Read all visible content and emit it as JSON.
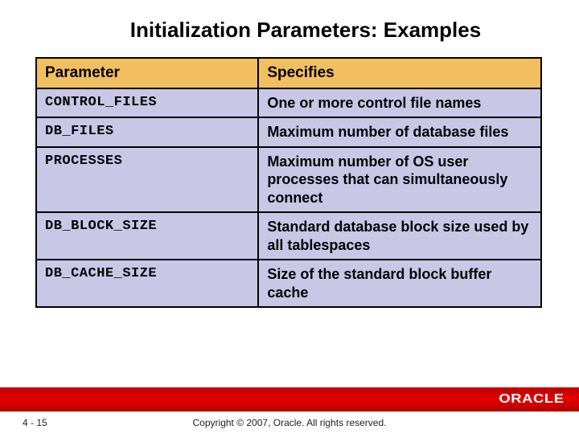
{
  "title": "Initialization Parameters: Examples",
  "table": {
    "headers": {
      "col1": "Parameter",
      "col2": "Specifies"
    },
    "rows": [
      {
        "param": "CONTROL_FILES",
        "spec": "One or more control file names"
      },
      {
        "param": "DB_FILES",
        "spec": "Maximum number of database files"
      },
      {
        "param": "PROCESSES",
        "spec": "Maximum number of OS user processes that can simultaneously connect"
      },
      {
        "param": "DB_BLOCK_SIZE",
        "spec": "Standard database block size used by all tablespaces"
      },
      {
        "param": "DB_CACHE_SIZE",
        "spec": "Size of the standard block buffer cache"
      }
    ]
  },
  "footer": {
    "page": "4 - 15",
    "copyright": "Copyright © 2007, Oracle. All rights reserved.",
    "logo": "ORACLE"
  }
}
